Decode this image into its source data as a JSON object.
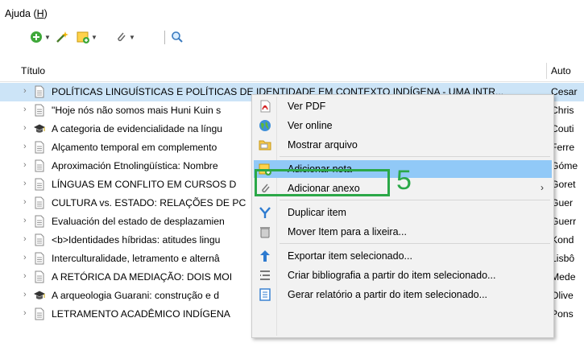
{
  "menubar": {
    "help_label": "Ajuda (H)"
  },
  "toolbar": {
    "icons": [
      "add-circle-icon",
      "magic-wand-icon",
      "new-note-icon",
      "paperclip-icon",
      "search-icon"
    ]
  },
  "columns": {
    "title": "Título",
    "author": "Auto"
  },
  "rows": [
    {
      "title": "POLÍTICAS LINGUÍSTICAS E POLÍTICAS DE IDENTIDADE EM CONTEXTO INDÍGENA - UMA INTR...",
      "author": "Cesar",
      "icon": "document",
      "selected": true
    },
    {
      "title": "\"Hoje nós não somos mais Huni Kuin s",
      "author": "Chris",
      "icon": "document"
    },
    {
      "title": "A categoria de evidencialidade na língu",
      "author": "Couti",
      "icon": "thesis"
    },
    {
      "title": "Alçamento temporal em complemento",
      "author": "Ferre",
      "icon": "document"
    },
    {
      "title": "Aproximación Etnolingüística: Nombre",
      "author": "Góme",
      "icon": "document"
    },
    {
      "title": "LÍNGUAS EM CONFLITO EM CURSOS D",
      "author": "Goret",
      "icon": "document"
    },
    {
      "title": "CULTURA vs. ESTADO: RELAÇÕES DE PC",
      "author": "Guer",
      "icon": "document"
    },
    {
      "title": "Evaluación del estado de desplazamien",
      "author": "Guerr",
      "icon": "document"
    },
    {
      "title": "<b>Identidades híbridas: atitudes lingu",
      "author": "Kond",
      "icon": "document"
    },
    {
      "title": "Interculturalidade, letramento e alternâ",
      "author": "Lisbô",
      "icon": "document"
    },
    {
      "title": "A RETÓRICA DA MEDIAÇÃO: DOIS MOI",
      "author": "Mede",
      "icon": "document"
    },
    {
      "title": "A arqueologia Guarani: construção e d",
      "author": "Olive",
      "icon": "thesis"
    },
    {
      "title": "LETRAMENTO ACADÊMICO INDÍGENA",
      "author": "Pons",
      "icon": "document"
    }
  ],
  "context_menu": {
    "items": [
      {
        "label": "Ver PDF",
        "icon": "pdf-icon"
      },
      {
        "label": "Ver online",
        "icon": "globe-icon"
      },
      {
        "label": "Mostrar arquivo",
        "icon": "folder-icon"
      },
      {
        "label": "Adicionar nota",
        "icon": "add-note-icon",
        "highlighted": true
      },
      {
        "label": "Adicionar anexo",
        "icon": "paperclip-icon",
        "submenu": true
      },
      {
        "label": "Duplicar item",
        "icon": "duplicate-icon"
      },
      {
        "label": "Mover Item para a lixeira...",
        "icon": "trash-icon"
      },
      {
        "label": "Exportar item selecionado...",
        "icon": "export-icon"
      },
      {
        "label": "Criar bibliografia a partir do item selecionado...",
        "icon": "bibliography-icon"
      },
      {
        "label": "Gerar relatório a partir do item selecionado...",
        "icon": "report-icon"
      }
    ]
  },
  "annotation": {
    "step_number": "5",
    "color": "#2ba848"
  }
}
